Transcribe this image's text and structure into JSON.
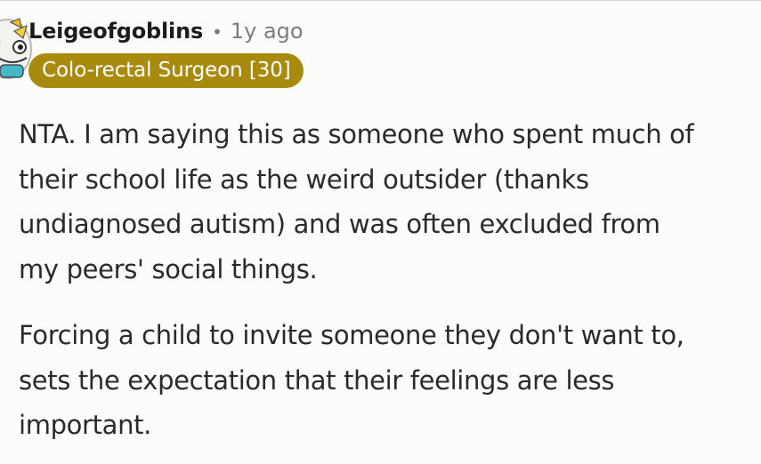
{
  "comment": {
    "author": "Leigeofgoblins",
    "separator": "•",
    "age": "1y ago",
    "flair": "Colo-rectal Surgeon [30]",
    "avatar_icon": "snoo-avatar-icon",
    "paragraphs": [
      {
        "lines": [
          "NTA. I am saying this as someone who spent much of",
          "their school life as the weird outsider (thanks",
          "undiagnosed autism) and was often excluded from",
          "my peers' social things."
        ]
      },
      {
        "lines": [
          "Forcing a child to invite someone they don't want to,",
          "sets the expectation that their feelings are less",
          "important."
        ]
      }
    ]
  },
  "colors": {
    "flair_bg": "#a88a0c",
    "flair_text": "#ffffff",
    "meta_gray": "#7c7c7c",
    "background": "#fcfcfb"
  }
}
